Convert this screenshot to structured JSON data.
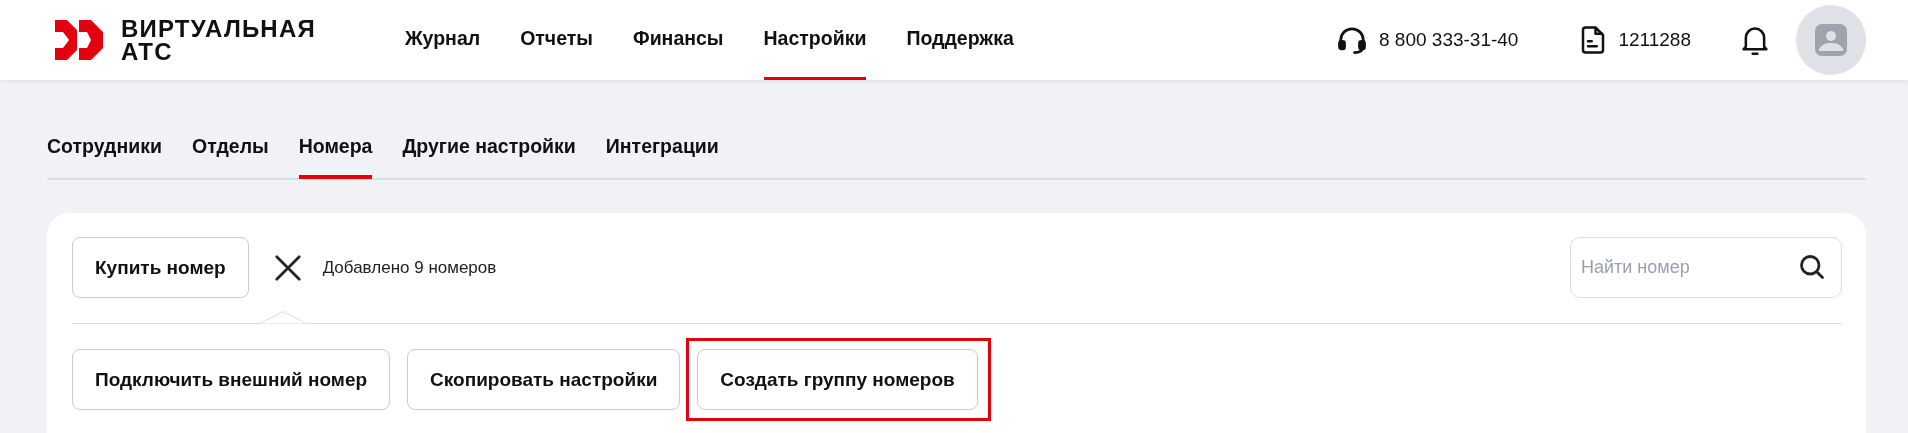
{
  "header": {
    "logo": {
      "line_1": "ВИРТУАЛЬНАЯ",
      "line_2": "АТС"
    },
    "nav": [
      {
        "label": "Журнал",
        "selected": false
      },
      {
        "label": "Отчеты",
        "selected": false
      },
      {
        "label": "Финансы",
        "selected": false
      },
      {
        "label": "Настройки",
        "selected": true
      },
      {
        "label": "Поддержка",
        "selected": false
      }
    ],
    "phone": "8 800 333-31-40",
    "account": "1211288"
  },
  "subtabs": [
    {
      "label": "Сотрудники",
      "selected": false
    },
    {
      "label": "Отделы",
      "selected": false
    },
    {
      "label": "Номера",
      "selected": true
    },
    {
      "label": "Другие настройки",
      "selected": false
    },
    {
      "label": "Интеграции",
      "selected": false
    }
  ],
  "toolbar": {
    "buy_button": "Купить номер",
    "status": "Добавлено 9 номеров",
    "search": {
      "placeholder": "Найти номер"
    }
  },
  "actions": [
    {
      "label": "Подключить внешний номер",
      "highlighted": false
    },
    {
      "label": "Скопировать настройки",
      "highlighted": false
    },
    {
      "label": "Создать группу номеров",
      "highlighted": true
    }
  ]
}
